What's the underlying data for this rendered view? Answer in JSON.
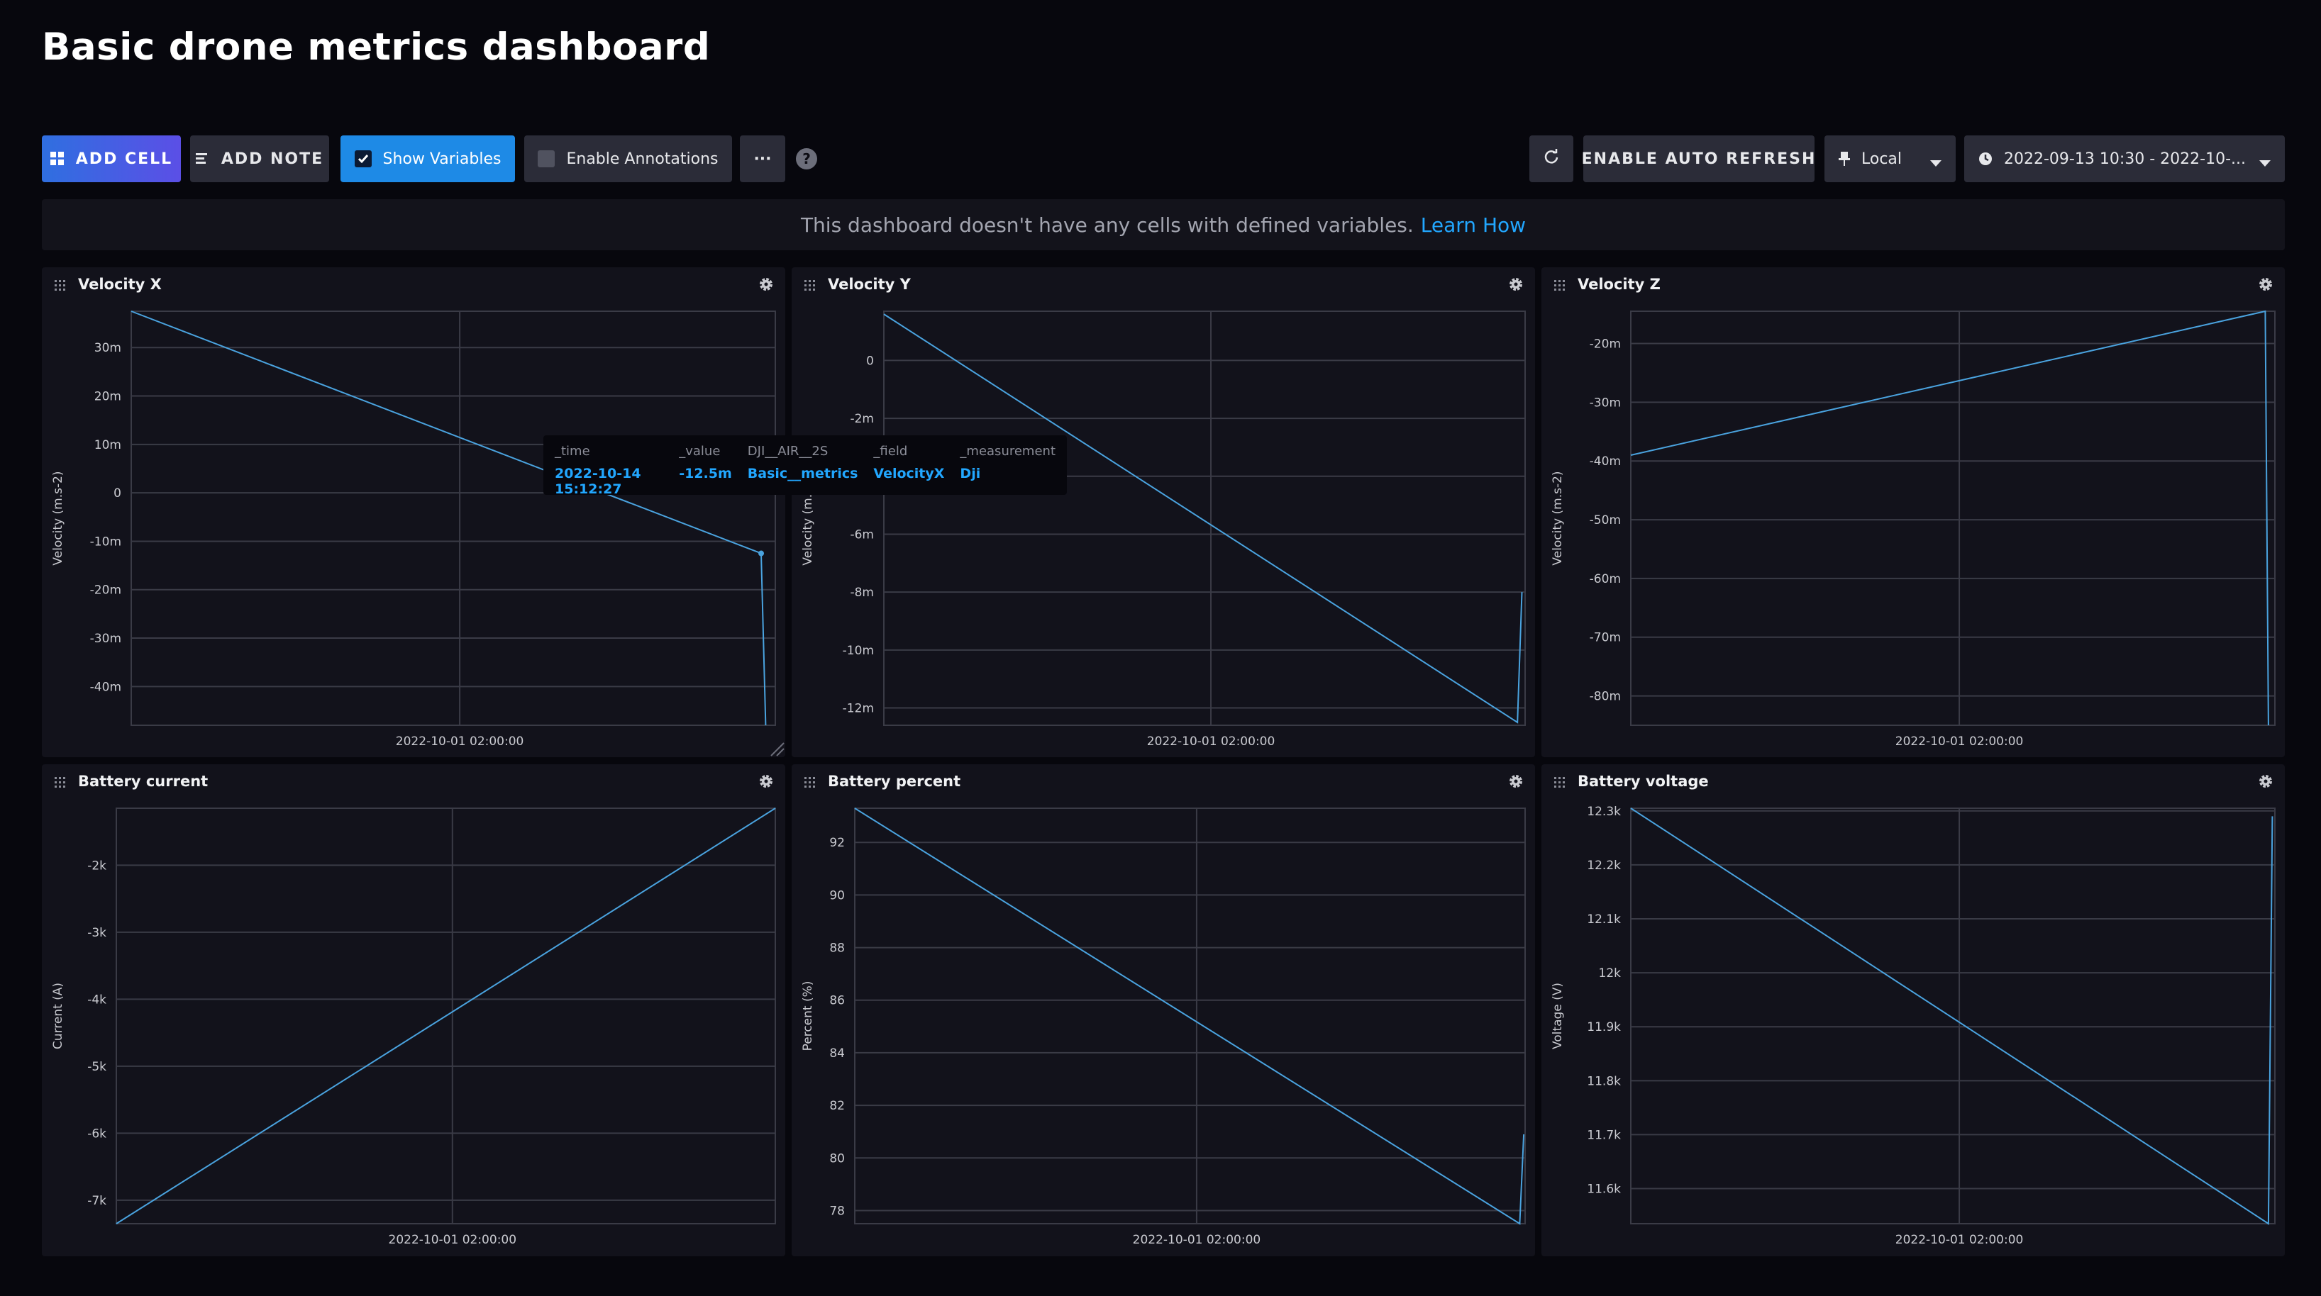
{
  "page": {
    "title": "Basic drone metrics dashboard"
  },
  "toolbar": {
    "add_cell": "ADD CELL",
    "add_note": "ADD NOTE",
    "show_variables": "Show Variables",
    "enable_annotations": "Enable Annotations",
    "more": "···",
    "help": "?",
    "auto_refresh": "ENABLE AUTO REFRESH",
    "timezone": "Local",
    "time_range": "2022-09-13 10:30 - 2022-10-..."
  },
  "banner": {
    "text": "This dashboard doesn't have any cells with defined variables.",
    "link": "Learn How"
  },
  "colors": {
    "line": "#4aa3df",
    "accent": "#22a7ff",
    "grid": "#3a3b46",
    "panel": "#12121b"
  },
  "tooltip": {
    "columns": [
      {
        "header": "_time",
        "value": "2022-10-14 15:12:27"
      },
      {
        "header": "_value",
        "value": "-12.5m"
      },
      {
        "header": "DJI__AIR__2S",
        "value": "Basic__metrics"
      },
      {
        "header": "_field",
        "value": "VelocityX"
      },
      {
        "header": "_measurement",
        "value": "Dji"
      }
    ]
  },
  "chart_data": [
    {
      "type": "line",
      "title": "Velocity X",
      "ylabel": "Velocity (m.s-2)",
      "x_tick": "2022-10-01 02:00:00",
      "y_ticks": [
        "30m",
        "20m",
        "10m",
        "0",
        "-10m",
        "-20m",
        "-30m",
        "-40m"
      ],
      "y_tick_values": [
        30,
        20,
        10,
        0,
        -10,
        -20,
        -30,
        -40
      ],
      "ylim": [
        -48,
        37.5
      ],
      "points": [
        [
          0,
          37.5
        ],
        [
          0.978,
          -12.5
        ],
        [
          0.985,
          -48
        ]
      ]
    },
    {
      "type": "line",
      "title": "Velocity Y",
      "ylabel": "Velocity (m.s-2)",
      "x_tick": "2022-10-01 02:00:00",
      "y_ticks": [
        "0",
        "-2m",
        "-4m",
        "-6m",
        "-8m",
        "-10m",
        "-12m"
      ],
      "y_tick_values": [
        0,
        -2,
        -4,
        -6,
        -8,
        -10,
        -12
      ],
      "ylim": [
        -12.6,
        1.7
      ],
      "points": [
        [
          0,
          1.6
        ],
        [
          0.988,
          -12.5
        ],
        [
          0.995,
          -8
        ]
      ]
    },
    {
      "type": "line",
      "title": "Velocity Z",
      "ylabel": "Velocity (m.s-2)",
      "x_tick": "2022-10-01 02:00:00",
      "y_ticks": [
        "-20m",
        "-30m",
        "-40m",
        "-50m",
        "-60m",
        "-70m",
        "-80m"
      ],
      "y_tick_values": [
        -20,
        -30,
        -40,
        -50,
        -60,
        -70,
        -80
      ],
      "ylim": [
        -85,
        -14.5
      ],
      "points": [
        [
          0,
          -39
        ],
        [
          0.985,
          -14.5
        ],
        [
          0.99,
          -85
        ]
      ]
    },
    {
      "type": "line",
      "title": "Battery current",
      "ylabel": "Current (A)",
      "x_tick": "2022-10-01 02:00:00",
      "y_ticks": [
        "-2k",
        "-3k",
        "-4k",
        "-5k",
        "-6k",
        "-7k"
      ],
      "y_tick_values": [
        -2000,
        -3000,
        -4000,
        -5000,
        -6000,
        -7000
      ],
      "ylim": [
        -7350,
        -1150
      ],
      "points": [
        [
          0,
          -7350
        ],
        [
          1,
          -1150
        ]
      ]
    },
    {
      "type": "line",
      "title": "Battery percent",
      "ylabel": "Percent (%)",
      "x_tick": "2022-10-01 02:00:00",
      "y_ticks": [
        "92",
        "90",
        "88",
        "86",
        "84",
        "82",
        "80",
        "78"
      ],
      "y_tick_values": [
        92,
        90,
        88,
        86,
        84,
        82,
        80,
        78
      ],
      "ylim": [
        77.5,
        93.3
      ],
      "points": [
        [
          0,
          93.3
        ],
        [
          0.992,
          77.5
        ],
        [
          0.998,
          80.9
        ]
      ]
    },
    {
      "type": "line",
      "title": "Battery voltage",
      "ylabel": "Voltage (V)",
      "x_tick": "2022-10-01 02:00:00",
      "y_ticks": [
        "12.3k",
        "12.2k",
        "12.1k",
        "12k",
        "11.9k",
        "11.8k",
        "11.7k",
        "11.6k"
      ],
      "y_tick_values": [
        12300,
        12200,
        12100,
        12000,
        11900,
        11800,
        11700,
        11600
      ],
      "ylim": [
        11535,
        12305
      ],
      "points": [
        [
          0,
          12305
        ],
        [
          0.99,
          11535
        ],
        [
          0.996,
          12290
        ]
      ]
    }
  ]
}
